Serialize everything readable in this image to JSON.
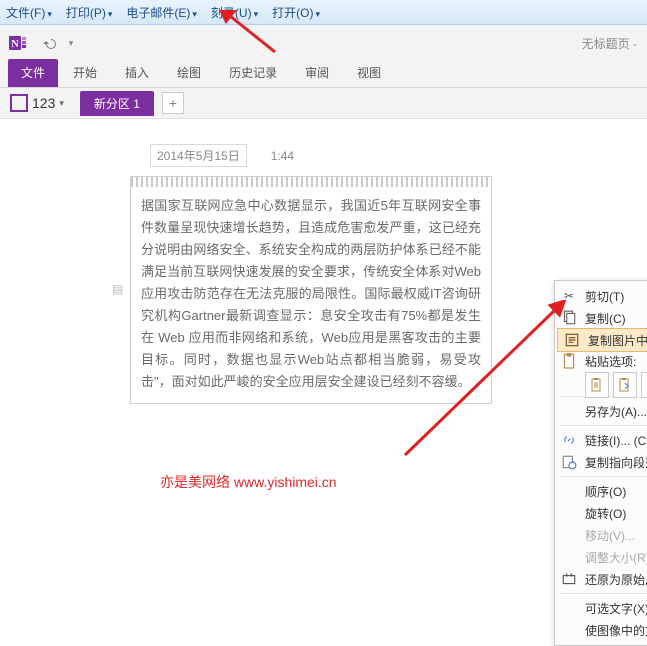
{
  "os_menu": {
    "file": "文件(F)",
    "print": "打印(P)",
    "email": "电子邮件(E)",
    "record": "刻录(U)",
    "open": "打开(O)"
  },
  "window": {
    "doc_title": "无标题页 -"
  },
  "ribbon": {
    "file": "文件",
    "home": "开始",
    "insert": "插入",
    "draw": "绘图",
    "history": "历史记录",
    "review": "审阅",
    "view": "视图"
  },
  "notebook": {
    "name": "123",
    "section": "新分区 1",
    "add": "+"
  },
  "page": {
    "date": "2014年5月15日",
    "time": "1:44",
    "paragraph": "据国家互联网应急中心数据显示，我国近5年互联网安全事件数量呈现快速增长趋势，且造成危害愈发严重，这已经充分说明由网络安全、系统安全构成的两层防护体系已经不能满足当前互联网快速发展的安全要求，传统安全体系对Web应用攻击防范存在无法克服的局限性。国际最权威IT咨询研究机构Gartner最新调查显示：息安全攻击有75%都是发生在 Web 应用而非网络和系统，Web应用是黑客攻击的主要目标。同时，数据也显示Web站点都相当脆弱，易受攻击\"，面对如此严峻的安全应用层安全建设已经刻不容缓。"
  },
  "watermark": {
    "site_name": "亦是美网络",
    "url": "www.yishimei.cn"
  },
  "ctx": {
    "cut": "剪切(T)",
    "copy": "复制(C)",
    "copy_text": "复制图片中的文本(E)",
    "paste_label": "粘贴选项:",
    "saveas": "另存为(A)...",
    "link": "链接(I)...  (Ctrl+K)",
    "copy_para_link": "复制指向段落的链接(P)",
    "order": "顺序(O)",
    "rotate": "旋转(O)",
    "move": "移动(V)...",
    "resize": "调整大小(R)",
    "restore": "还原为原始尺寸",
    "alt_text": "可选文字(X)...",
    "ocr_index": "使图像中的文本可搜索(K)"
  }
}
